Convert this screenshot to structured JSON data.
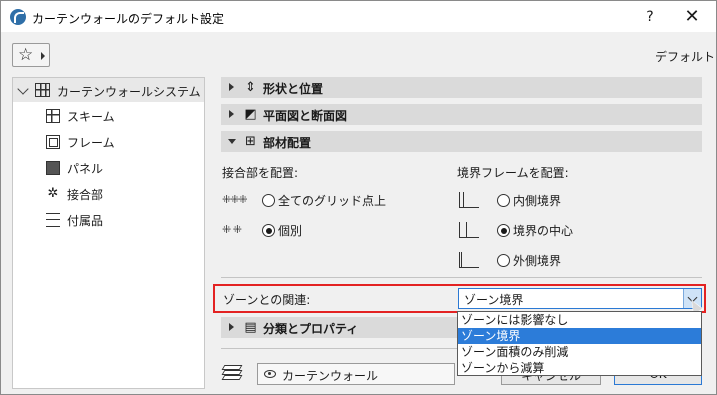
{
  "window": {
    "title": "カーテンウォールのデフォルト設定",
    "help": "?",
    "close": "✕"
  },
  "toolbar": {
    "favorites_icon": "star-icon",
    "default_label": "デフォルト"
  },
  "sidebar": {
    "root": {
      "label": "カーテンウォールシステム",
      "icon": "curtain-wall-system-icon"
    },
    "items": [
      {
        "label": "スキーム",
        "icon": "scheme-icon"
      },
      {
        "label": "フレーム",
        "icon": "frame-icon"
      },
      {
        "label": "パネル",
        "icon": "panel-icon"
      },
      {
        "label": "接合部",
        "icon": "junction-icon"
      },
      {
        "label": "付属品",
        "icon": "accessory-icon"
      }
    ]
  },
  "sections": {
    "shape": "形状と位置",
    "plan": "平面図と断面図",
    "members": "部材配置",
    "classification": "分類とプロパティ"
  },
  "members": {
    "junction_label": "接合部を配置:",
    "junction_options": [
      "全てのグリッド点上",
      "個別"
    ],
    "junction_selected": 1,
    "boundary_label": "境界フレームを配置:",
    "boundary_options": [
      "内側境界",
      "境界の中心",
      "外側境界"
    ],
    "boundary_selected": 1
  },
  "zone": {
    "label": "ゾーンとの関連:",
    "value": "ゾーン境界",
    "options": [
      "ゾーンには影響なし",
      "ゾーン境界",
      "ゾーン面積のみ削減",
      "ゾーンから減算"
    ],
    "selected_index": 1
  },
  "footer": {
    "layer_value": "カーテンウォール",
    "cancel_label": "キャンセル",
    "ok_label": "OK"
  },
  "colors": {
    "highlight": "#e32222",
    "selection": "#2c7cd9",
    "section_bg": "#dadada"
  }
}
